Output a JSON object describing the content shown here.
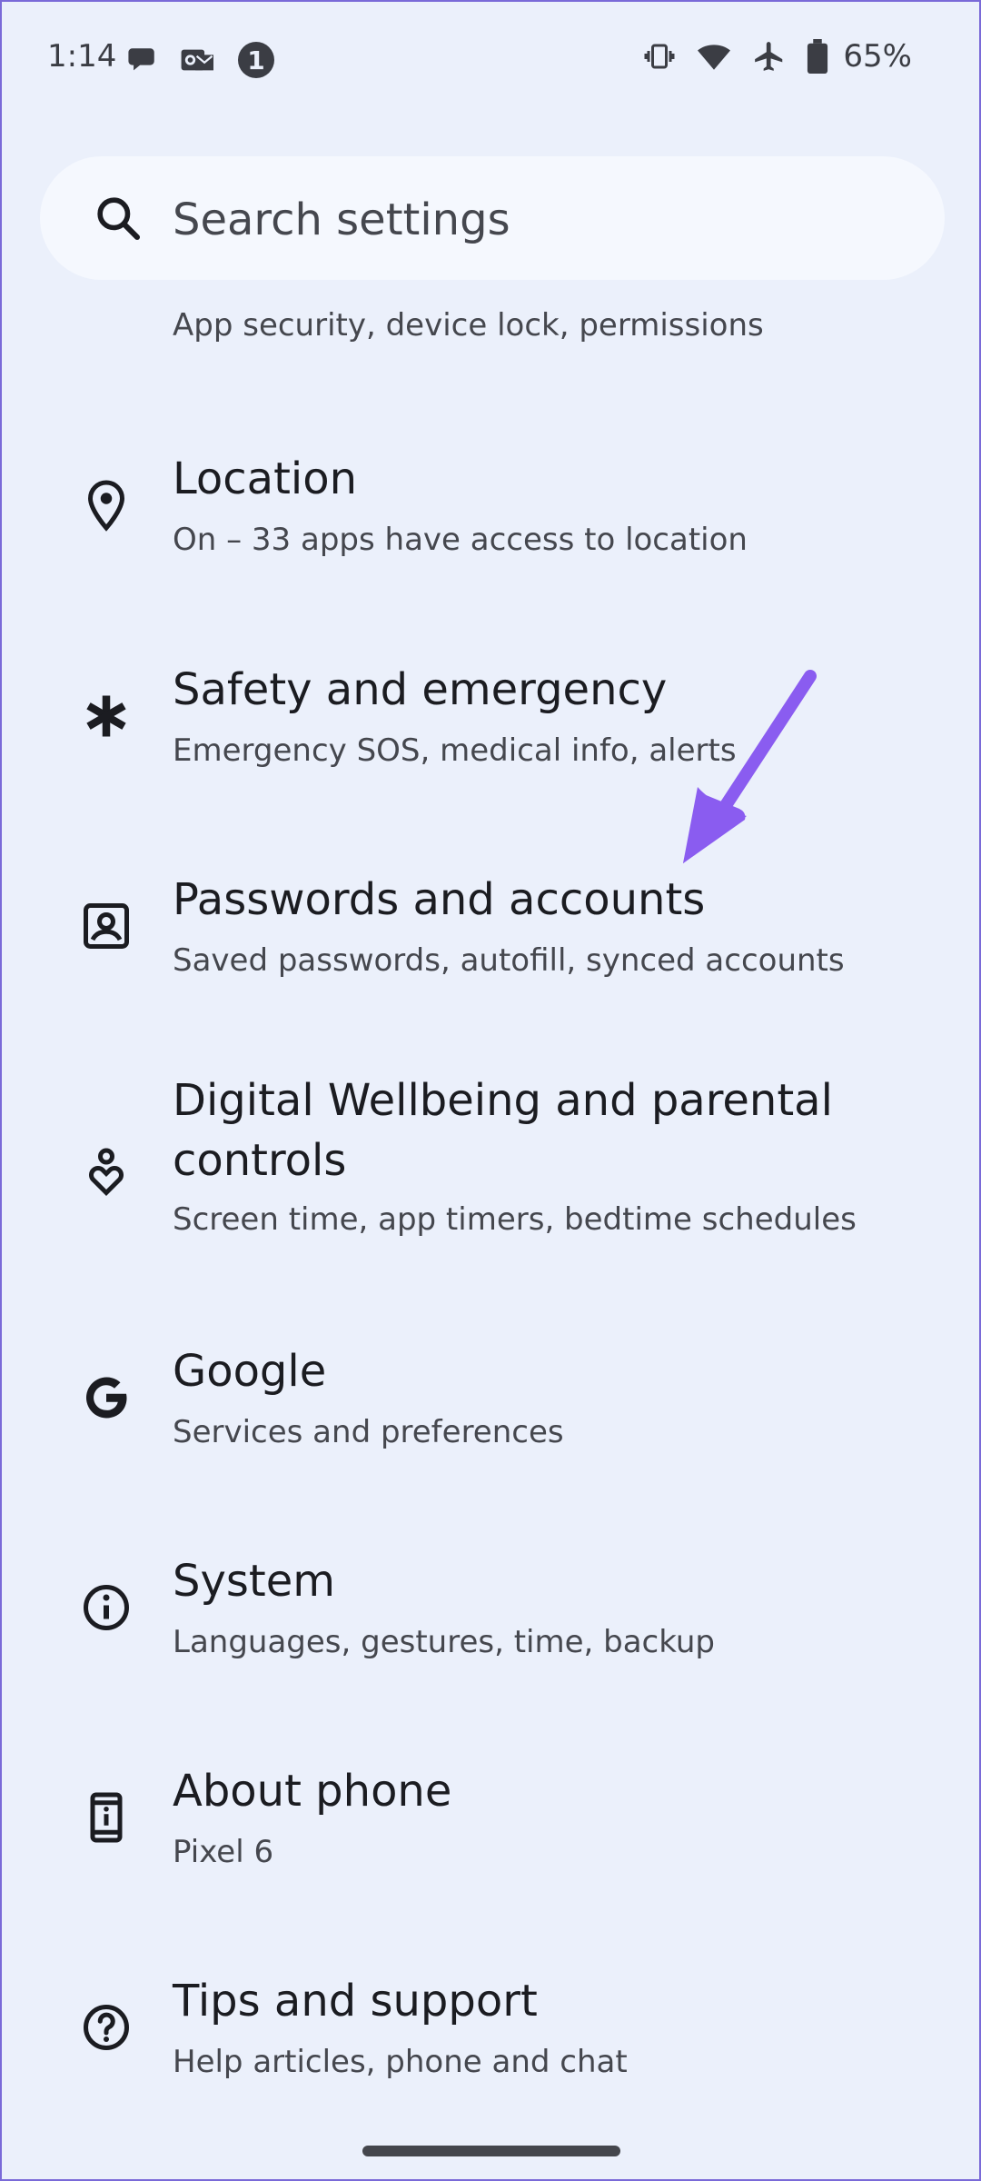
{
  "status_bar": {
    "time": "1:14",
    "battery_percent": "65%",
    "notification_icons": [
      "chat-bubble-icon",
      "mail-icon",
      "badge-icon"
    ],
    "system_icons": [
      "vibrate-icon",
      "wifi-icon",
      "airplane-mode-icon",
      "battery-icon"
    ],
    "badge_number": "1"
  },
  "search": {
    "placeholder": "Search settings"
  },
  "partial_item": {
    "summary": "App security, device lock, permissions"
  },
  "items": [
    {
      "title": "Location",
      "summary": "On – 33 apps have access to location",
      "icon": "location-pin-icon"
    },
    {
      "title": "Safety and emergency",
      "summary": "Emergency SOS, medical info, alerts",
      "icon": "asterisk-icon"
    },
    {
      "title": "Passwords and accounts",
      "summary": "Saved passwords, autofill, synced accounts",
      "icon": "account-box-icon"
    },
    {
      "title": "Digital Wellbeing and parental controls",
      "summary": "Screen time, app timers, bedtime schedules",
      "icon": "wellbeing-icon"
    },
    {
      "title": "Google",
      "summary": "Services and preferences",
      "icon": "google-g-icon"
    },
    {
      "title": "System",
      "summary": "Languages, gestures, time, backup",
      "icon": "info-icon"
    },
    {
      "title": "About phone",
      "summary": "Pixel 6",
      "icon": "phone-info-icon"
    },
    {
      "title": "Tips and support",
      "summary": "Help articles, phone and chat",
      "icon": "help-icon"
    }
  ],
  "colors": {
    "background": "#ebf0fb",
    "search_bg": "#f5f8fe",
    "annotation_arrow": "#8a5cf0",
    "icon": "#1b1c21"
  }
}
